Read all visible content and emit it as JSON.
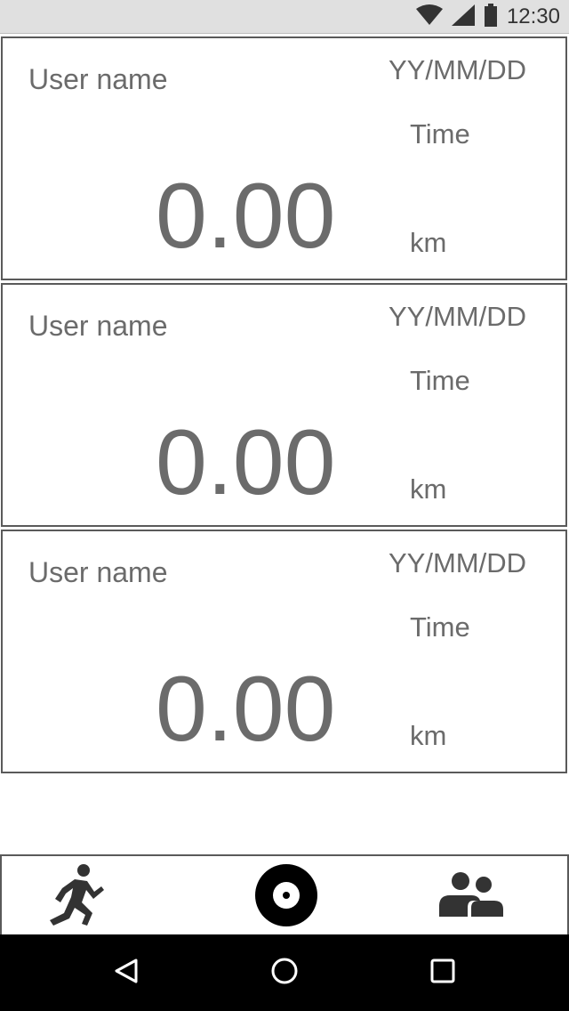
{
  "status_bar": {
    "time": "12:30",
    "icons": [
      "wifi-icon",
      "cellular-signal-icon",
      "battery-icon"
    ]
  },
  "cards": [
    {
      "user_name": "User name",
      "date": "YY/MM/DD",
      "time": "Time",
      "distance": "0.00",
      "unit": "km"
    },
    {
      "user_name": "User name",
      "date": "YY/MM/DD",
      "time": "Time",
      "distance": "0.00",
      "unit": "km"
    },
    {
      "user_name": "User name",
      "date": "YY/MM/DD",
      "time": "Time",
      "distance": "0.00",
      "unit": "km"
    }
  ],
  "bottom_nav": {
    "items": [
      {
        "icon": "running-person-icon"
      },
      {
        "icon": "record-disc-icon"
      },
      {
        "icon": "group-people-icon"
      }
    ]
  },
  "system_nav": {
    "buttons": [
      {
        "icon": "back-triangle-icon"
      },
      {
        "icon": "home-circle-icon"
      },
      {
        "icon": "recents-square-icon"
      }
    ]
  },
  "colors": {
    "text": "#6b6b6b",
    "border": "#5a5a5a",
    "status_bar_bg": "#e0e0e0",
    "system_nav_bg": "#000000"
  }
}
